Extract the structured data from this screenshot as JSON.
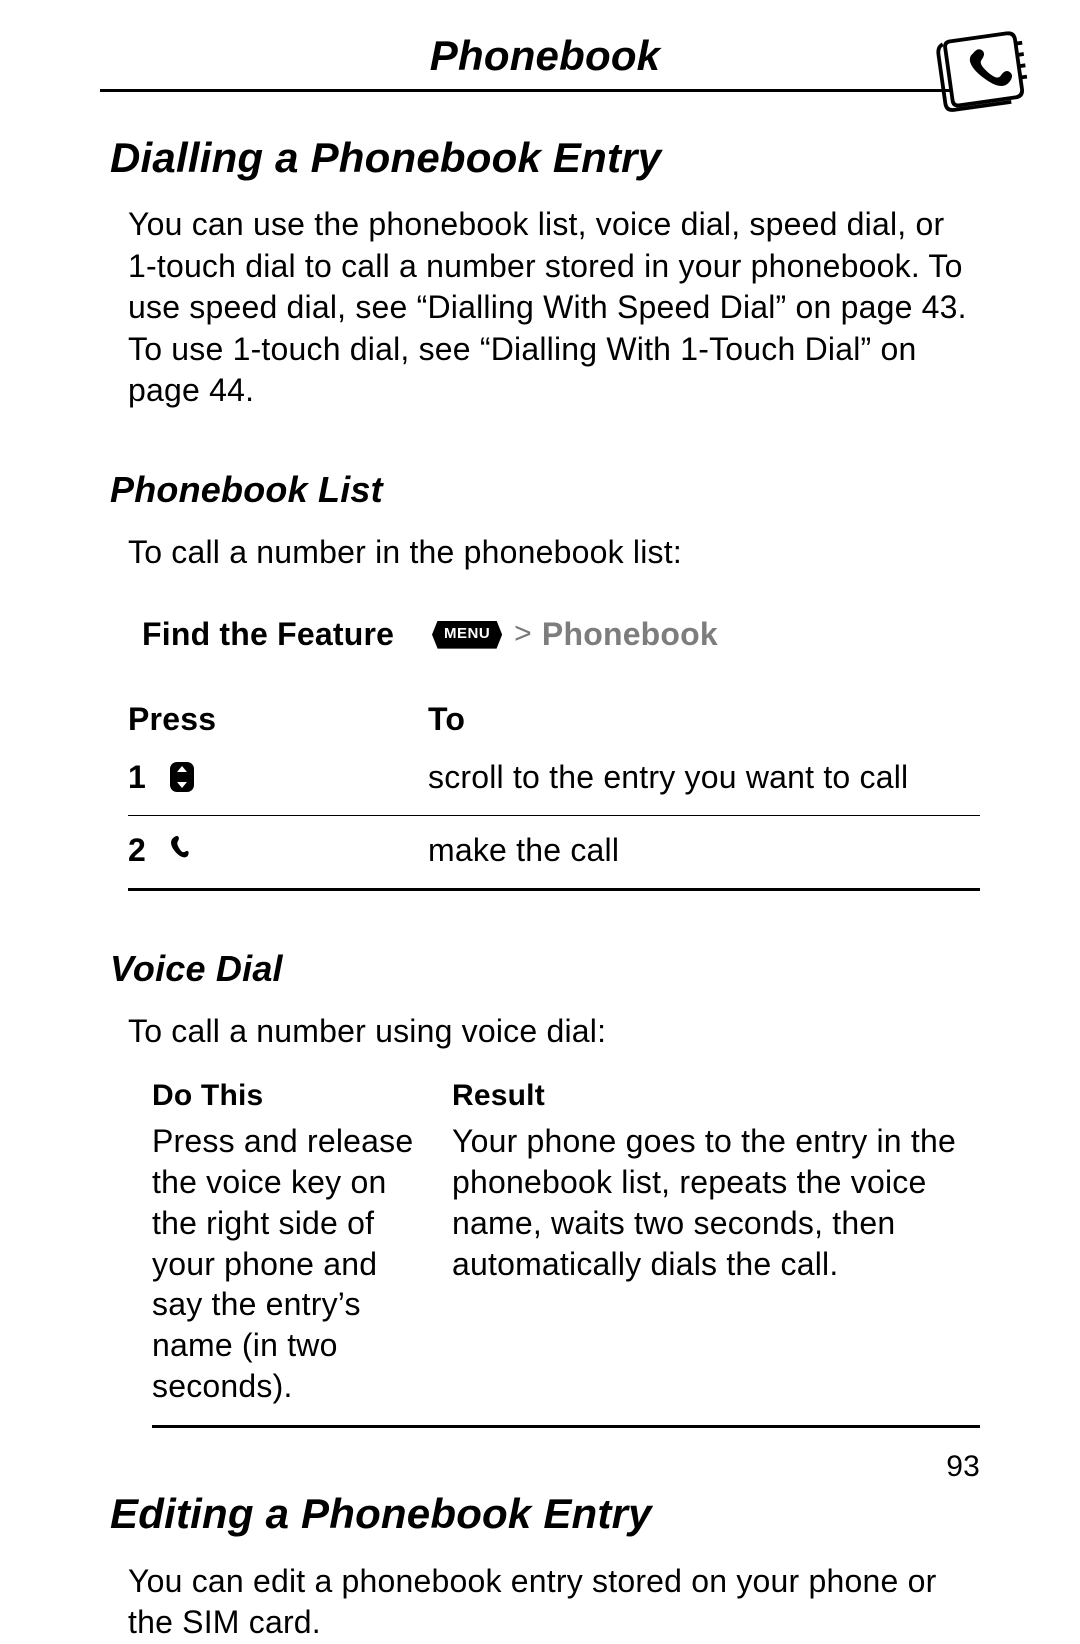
{
  "header": {
    "title": "Phonebook"
  },
  "section1": {
    "title": "Dialling a Phonebook Entry",
    "intro": "You can use the phonebook list, voice dial, speed dial, or 1-touch dial to call a number stored in your phonebook. To use speed dial, see “Dialling With Speed Dial” on page 43. To use 1-touch dial, see “Dialling With 1-Touch Dial” on page 44."
  },
  "phonebook_list": {
    "title": "Phonebook List",
    "intro": "To call a number in the phonebook list:",
    "find_feature_label": "Find the Feature",
    "menu_key_label": "MENU",
    "gt": ">",
    "menu_item": "Phonebook",
    "press_header": "Press",
    "to_header": "To",
    "steps": [
      {
        "num": "1",
        "to": "scroll to the entry you want to call"
      },
      {
        "num": "2",
        "to": "make the call"
      }
    ]
  },
  "voice_dial": {
    "title": "Voice Dial",
    "intro": "To call a number using voice dial:",
    "do_this_header": "Do This",
    "result_header": "Result",
    "do_this": "Press and release the voice key on the right side of your phone and say the entry’s name (in two seconds).",
    "result": "Your phone goes to the entry in the phonebook list, repeats the voice name, waits two seconds, then automatically dials the call."
  },
  "section2": {
    "title": "Editing a Phonebook Entry",
    "intro": "You can edit a phonebook entry stored on your phone or the SIM card."
  },
  "page_number": "93"
}
